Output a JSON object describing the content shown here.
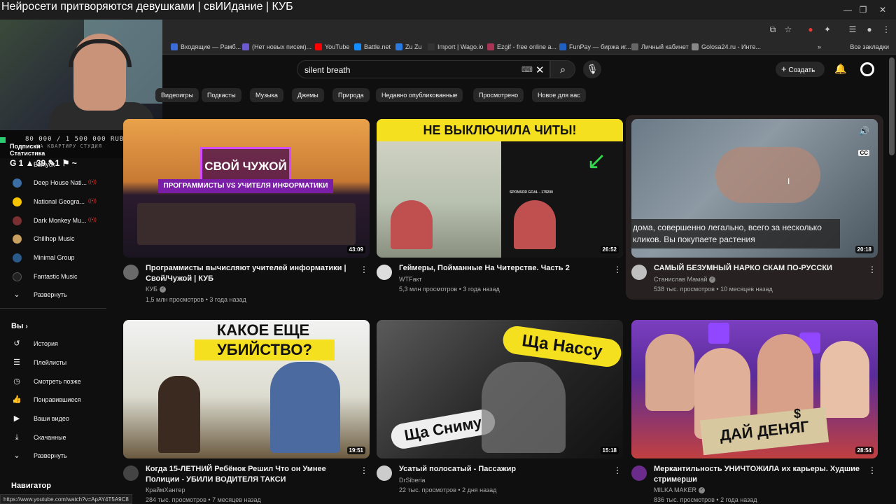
{
  "stream": {
    "title": "Нейросети притворяются девушками | свИИдание | КУБ"
  },
  "browser": {
    "bookmarks": [
      "Входящие — Рамб...",
      "(Нет новых писем)...",
      "YouTube",
      "Battle.net",
      "Zu Zu",
      "Import | Wago.io",
      "Ezgif - free online a...",
      "FunPay — биржа иг...",
      "Личный кабинет",
      "Golosa24.ru - Инте..."
    ],
    "bookmark_colors": [
      "#3b6bd6",
      "#6a5acd",
      "#ff0000",
      "#148eff",
      "#2a7ae2",
      "#333333",
      "#aa3355",
      "#2060c0",
      "#666666",
      "#888888"
    ],
    "all_bookmarks": "Все закладки",
    "status_url": "https://www.youtube.com/watch?v=ApAY4T5A9C8"
  },
  "overlay": {
    "donation_amount": "80 000 / 1 500 000 RUB",
    "donation_goal": "НА КВАРТИРУ СТУДИЯ",
    "stats_label_1": "Подписки",
    "stats_label_2": "Статистика",
    "stats_values": "G 1  ▲ 39  ✎1  ⚑ ~"
  },
  "search": {
    "query": "silent breath"
  },
  "header": {
    "create_label": "Создать"
  },
  "chips": [
    "Видеоигры",
    "Подкасты",
    "Музыка",
    "Джемы",
    "Природа",
    "Недавно опубликованные",
    "Просмотрено",
    "Новое для вас"
  ],
  "sidebar": {
    "subscriptions": [
      {
        "label": "Deep House Nati...",
        "color": "#3a6ea5"
      },
      {
        "label": "National Geogra...",
        "color": "#f7c400"
      },
      {
        "label": "Dark Monkey Mu...",
        "color": "#7a3030"
      },
      {
        "label": "Chillhop Music",
        "color": "#c8a060"
      },
      {
        "label": "Minimal Group",
        "color": "#2a5a8a"
      },
      {
        "label": "Fantastic Music",
        "color": "#222222"
      }
    ],
    "first_item_label": "Выпуск",
    "expand_label": "Развернуть",
    "you_label": "Вы",
    "you_items": [
      "История",
      "Плейлисты",
      "Смотреть позже",
      "Понравившиеся",
      "Ваши видео",
      "Скачанные",
      "Развернуть"
    ],
    "navigator_label": "Навигатор"
  },
  "videos": [
    {
      "title": "Программисты вычисляют учителей информатики | Свой/Чужой | КУБ",
      "channel": "КУБ",
      "verified": true,
      "views": "1,5 млн просмотров",
      "age": "3 года назад",
      "duration": "43:09",
      "thumb_text": "СВОЙ ЧУЖОЙ",
      "thumb_sub": "ПРОГРАММИСТЫ VS УЧИТЕЛЯ ИНФОРМАТИКИ",
      "avatar_color": "#6a6a6a"
    },
    {
      "title": "Геймеры, Пойманные На Читерстве. Часть 2",
      "channel": "WTFакт",
      "verified": false,
      "views": "5,3 млн просмотров",
      "age": "3 года назад",
      "duration": "26:52",
      "thumb_text": "НЕ ВЫКЛЮЧИЛА ЧИТЫ!",
      "thumb_sub": "SPONSOR GOAL - 179200",
      "avatar_color": "#dddddd"
    },
    {
      "title": "САМЫЙ БЕЗУМНЫЙ НАРКО СКАМ ПО-РУССКИ",
      "channel": "Станислав Мамай",
      "verified": true,
      "views": "538 тыс. просмотров",
      "age": "10 месяцев назад",
      "duration": "20:18",
      "thumb_text": "дома, совершенно легально, всего за несколько кликов. Вы покупаете растения",
      "thumb_sub": "",
      "avatar_color": "#bfbfbf"
    },
    {
      "title": "Когда 15-ЛЕТНИЙ Ребёнок Решил Что он Умнее Полиции - УБИЛИ ВОДИТЕЛЯ ТАКСИ",
      "channel": "КраймХантер",
      "verified": false,
      "views": "284 тыс. просмотров",
      "age": "7 месяцев назад",
      "duration": "19:51",
      "thumb_text": "КАКОЕ ЕЩЕ",
      "thumb_sub": "УБИЙСТВО?",
      "avatar_color": "#444444"
    },
    {
      "title": "Усатый полосатый - Пассажир",
      "channel": "DrSiberia",
      "verified": false,
      "views": "22 тыс. просмотров",
      "age": "2 дня назад",
      "duration": "15:18",
      "thumb_text": "Ща Нассу",
      "thumb_sub": "Ща Сниму",
      "avatar_color": "#cccccc"
    },
    {
      "title": "Меркантильность УНИЧТОЖИЛА их карьеры. Худшие стримерши",
      "channel": "MILKA MAKER",
      "verified": true,
      "views": "836 тыс. просмотров",
      "age": "2 года назад",
      "duration": "28:54",
      "thumb_text": "ДАЙ ДЕНЯГ",
      "thumb_sub": "$",
      "avatar_color": "#6a2b8a"
    }
  ]
}
